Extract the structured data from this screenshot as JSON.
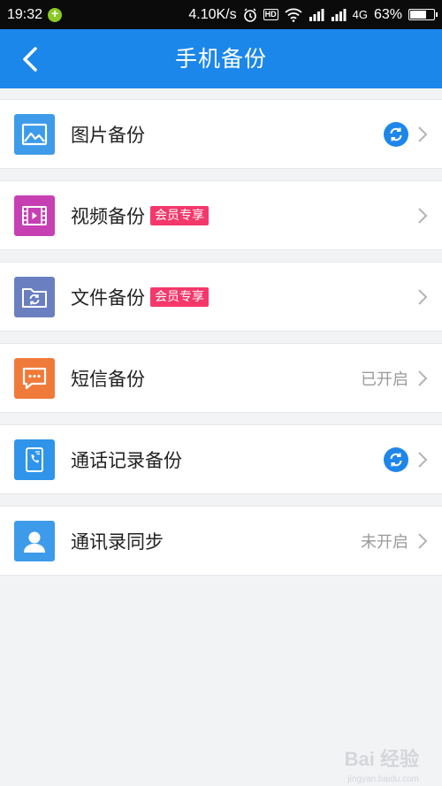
{
  "status_bar": {
    "time": "19:32",
    "network_speed": "4.10K/s",
    "hd": "HD",
    "network_type": "4G",
    "battery": "63%",
    "icons": [
      "notification-plus-icon",
      "alarm-icon",
      "hd-icon",
      "wifi-icon",
      "signal-icon",
      "signal-icon",
      "battery-icon"
    ]
  },
  "app_bar": {
    "title": "手机备份",
    "back_icon": "chevron-left-icon"
  },
  "items": [
    {
      "label": "图片备份",
      "badge": "",
      "status": "",
      "tile_icon": "image-icon",
      "tile_color": "#3d9be9",
      "has_sync": true
    },
    {
      "label": "视频备份",
      "badge": "会员专享",
      "status": "",
      "tile_icon": "video-icon",
      "tile_color": "#c640b3",
      "has_sync": false
    },
    {
      "label": "文件备份",
      "badge": "会员专享",
      "status": "",
      "tile_icon": "folder-sync-icon",
      "tile_color": "#6a7fc0",
      "has_sync": false
    },
    {
      "label": "短信备份",
      "badge": "",
      "status": "已开启",
      "tile_icon": "message-icon",
      "tile_color": "#f07a3a",
      "has_sync": false
    },
    {
      "label": "通话记录备份",
      "badge": "",
      "status": "",
      "tile_icon": "phone-log-icon",
      "tile_color": "#2f94ea",
      "has_sync": true
    },
    {
      "label": "通讯录同步",
      "badge": "",
      "status": "未开启",
      "tile_icon": "contact-icon",
      "tile_color": "#3d9be9",
      "has_sync": false
    }
  ],
  "colors": {
    "accent": "#1c87ea",
    "badge": "#f5386a",
    "background": "#f2f3f5"
  },
  "watermark": {
    "text": "Bai 经验",
    "sub": "jingyan.baidu.com"
  }
}
